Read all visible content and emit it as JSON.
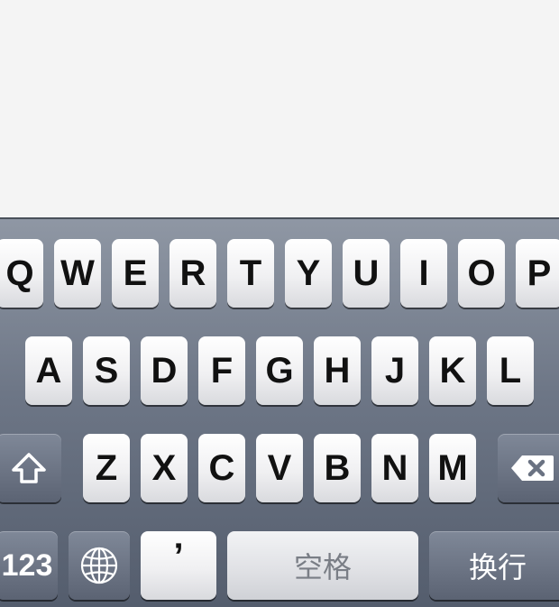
{
  "keyboard": {
    "row1": [
      "Q",
      "W",
      "E",
      "R",
      "T",
      "Y",
      "U",
      "I",
      "O",
      "P"
    ],
    "row2": [
      "A",
      "S",
      "D",
      "F",
      "G",
      "H",
      "J",
      "K",
      "L"
    ],
    "row3": [
      "Z",
      "X",
      "C",
      "V",
      "B",
      "N",
      "M"
    ],
    "numbers_label": "123",
    "apostrophe_label": "’",
    "space_label": "空格",
    "return_label": "换行",
    "shift_icon": "shift-arrow-icon",
    "delete_icon": "backspace-icon",
    "globe_icon": "globe-icon"
  },
  "colors": {
    "background": "#f4f4f4",
    "keyboard_top": "#8f97a4",
    "keyboard_bottom": "#545d6d",
    "key_light": "#ffffff",
    "key_dark": "#6a7282"
  }
}
